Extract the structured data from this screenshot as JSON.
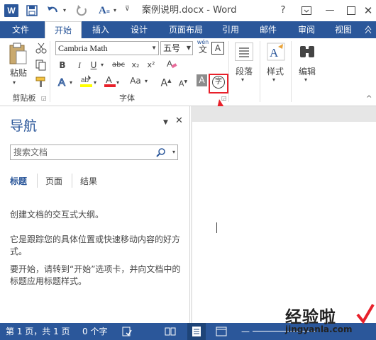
{
  "titlebar": {
    "app_icon": "word-logo-icon",
    "title": "案例说明.docx - Word",
    "help": "?",
    "quick_access": [
      "save-icon",
      "undo-icon",
      "redo-icon",
      "font-color-icon",
      "customize-icon"
    ]
  },
  "tabs": [
    {
      "label": "文件"
    },
    {
      "label": "开始"
    },
    {
      "label": "插入"
    },
    {
      "label": "设计"
    },
    {
      "label": "页面布局"
    },
    {
      "label": "引用"
    },
    {
      "label": "邮件"
    },
    {
      "label": "审阅"
    },
    {
      "label": "视图"
    }
  ],
  "ribbon": {
    "clipboard": {
      "paste_label": "粘贴",
      "group_label": "剪贴板"
    },
    "font": {
      "font_name": "Cambria Math",
      "font_size": "五号",
      "wen": "wén",
      "wen_char": "文",
      "a_box": "A",
      "bold": "B",
      "italic": "I",
      "underline": "U",
      "strike": "abc",
      "subscript": "x₂",
      "superscript": "x²",
      "aa": "Aa",
      "group_label": "字体",
      "enclose_char": "字"
    },
    "paragraph": {
      "label": "段落"
    },
    "styles": {
      "label": "样式"
    },
    "editing": {
      "label": "编辑"
    }
  },
  "nav": {
    "title": "导航",
    "search_placeholder": "搜索文档",
    "tabs": [
      "标题",
      "页面",
      "结果"
    ],
    "para1": "创建文档的交互式大纲。",
    "para2": "它是跟踪您的具体位置或快速移动内容的好方式。",
    "para3": "要开始，请转到“开始”选项卡，并向文档中的标题应用标题样式。"
  },
  "statusbar": {
    "page": "第 1 页，共 1 页",
    "words": "0 个字"
  },
  "watermark": {
    "text": "经验啦",
    "url": "jingyanla.com"
  },
  "colors": {
    "brand": "#2b579a",
    "highlight": "#e8202a"
  }
}
